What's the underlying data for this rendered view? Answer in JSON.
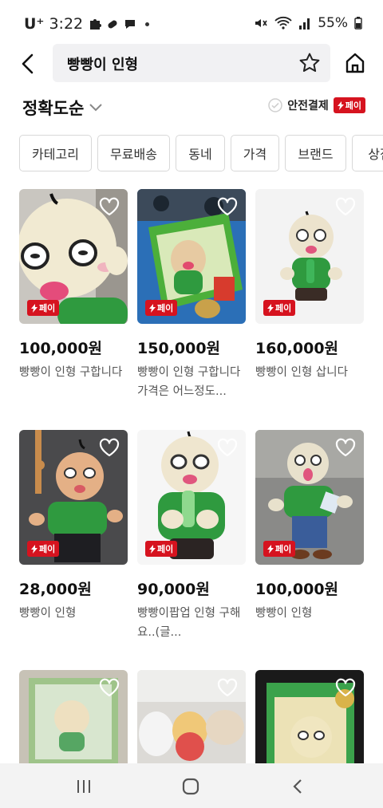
{
  "status_bar": {
    "carrier": "U⁺",
    "time": "3:22",
    "battery": "55%"
  },
  "header": {
    "search_query": "빵빵이 인형"
  },
  "sort": {
    "label": "정확도순",
    "safe_pay_label": "안전결제",
    "pay_badge": "페이"
  },
  "filters": [
    "카테고리",
    "무료배송",
    "동네",
    "가격",
    "브랜드",
    "상점"
  ],
  "products": [
    {
      "price": "100,000원",
      "title": "빵빵이 인형 구합니다",
      "pay": "페이"
    },
    {
      "price": "150,000원",
      "title": "빵빵이 인형 구합니다 가격은 어느정도...",
      "pay": "페이"
    },
    {
      "price": "160,000원",
      "title": "빵빵이 인형 삽니다",
      "pay": "페이"
    },
    {
      "price": "28,000원",
      "title": "빵빵이 인형",
      "pay": "페이"
    },
    {
      "price": "90,000원",
      "title": "빵빵이팝업 인형 구해요..(글...",
      "pay": "페이"
    },
    {
      "price": "100,000원",
      "title": "빵빵이 인형",
      "pay": "페이"
    }
  ],
  "colors": {
    "pay_red": "#d6131f",
    "plush_green": "#2f9a3f"
  }
}
